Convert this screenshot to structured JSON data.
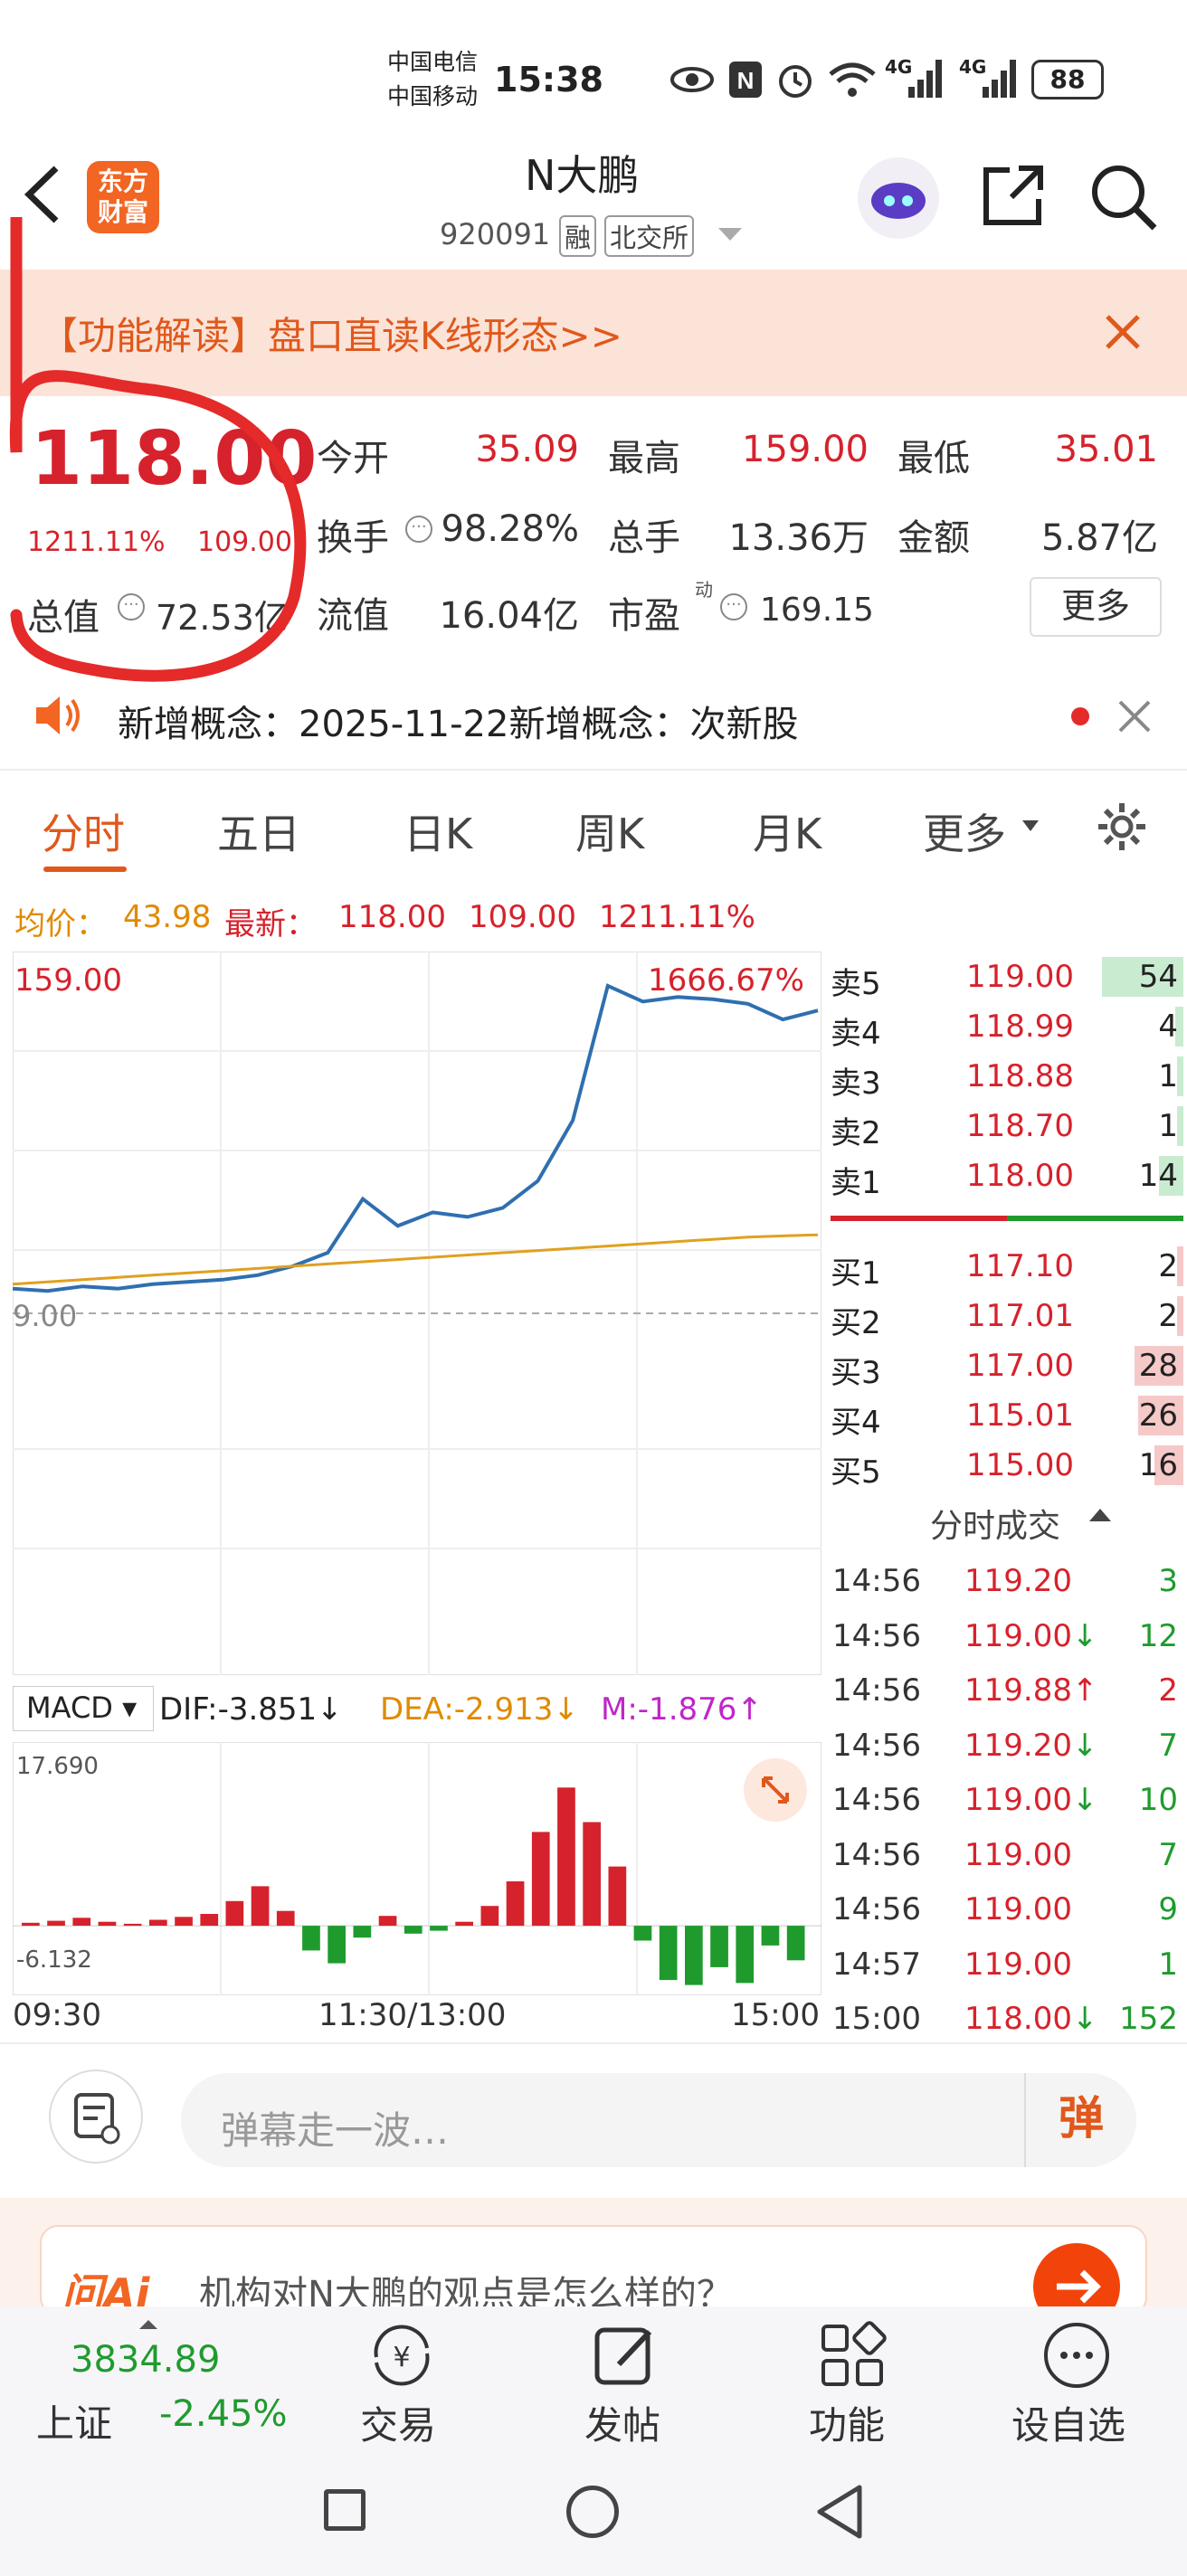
{
  "status": {
    "carrier1": "中国电信",
    "carrier2": "中国移动",
    "time": "15:38",
    "battery": "88",
    "net1": "4G",
    "net2": "4G"
  },
  "header": {
    "title": "N大鹏",
    "code": "920091",
    "tag_margin": "融",
    "tag_exchange": "北交所",
    "logo_line1": "东方",
    "logo_line2": "财富"
  },
  "banner": {
    "text": "【功能解读】盘口直读K线形态>>"
  },
  "quote": {
    "price": "118.00",
    "change_pct": "1211.11%",
    "change_abs": "109.00",
    "open_label": "今开",
    "open": "35.09",
    "high_label": "最高",
    "high": "159.00",
    "low_label": "最低",
    "low": "35.01",
    "turnover_label": "换手",
    "turnover": "98.28%",
    "volume_label": "总手",
    "volume": "13.36万",
    "amount_label": "金额",
    "amount": "5.87亿",
    "mcap_label": "总值",
    "mcap": "72.53亿",
    "float_label": "流值",
    "float_cap": "16.04亿",
    "pe_label": "市盈",
    "pe_sup": "动",
    "pe": "169.15",
    "more": "更多"
  },
  "notice": {
    "text": "新增概念：2025-11-22新增概念：次新股"
  },
  "tabs": [
    "分时",
    "五日",
    "日K",
    "周K",
    "月K",
    "更多"
  ],
  "summary": {
    "avg_label": "均价：",
    "avg": "43.98",
    "latest_label": "最新：",
    "latest": "118.00",
    "chg": "109.00",
    "pct": "1211.11%"
  },
  "chart_data": [
    {
      "type": "line",
      "title": "",
      "ymax_label": "159.00",
      "ymax_pct": "1666.67%",
      "prev_close_label": "9.00",
      "x_labels": [
        "09:30",
        "11:30/13:00",
        "15:00"
      ],
      "series": [
        {
          "values": [
            20,
            19,
            21,
            20,
            22,
            23,
            24,
            26,
            30,
            36,
            60,
            48,
            54,
            52,
            56,
            68,
            95,
            155,
            148,
            150,
            149,
            147,
            140,
            144
          ]
        },
        {
          "values": [
            22,
            23,
            24,
            25,
            26,
            27,
            28,
            29,
            30,
            31,
            32,
            33,
            34,
            35,
            36,
            37,
            38,
            39,
            40,
            41,
            42,
            43,
            43.5,
            43.98
          ]
        }
      ]
    },
    {
      "type": "bar",
      "title": "MACD",
      "indicator": "MACD",
      "dif": "DIF:-3.851↓",
      "dea": "DEA:-2.913↓",
      "m": "M:-1.876↑",
      "ymax": "17.690",
      "ymin": "-6.132",
      "values": [
        0.3,
        0.5,
        0.8,
        0.4,
        0.2,
        0.6,
        0.9,
        1.2,
        2.5,
        4.0,
        1.5,
        -2.5,
        -3.8,
        -1.2,
        1.0,
        -0.8,
        -0.5,
        0.4,
        2.0,
        4.5,
        9.5,
        14.0,
        10.5,
        6.0,
        -1.5,
        -5.5,
        -6.0,
        -4.2,
        -5.8,
        -2.0,
        -3.5
      ]
    }
  ],
  "orderbook": {
    "asks": [
      {
        "label": "卖5",
        "price": "119.00",
        "vol": "54",
        "fill": 0.5
      },
      {
        "label": "卖4",
        "price": "118.99",
        "vol": "4",
        "fill": 0.05
      },
      {
        "label": "卖3",
        "price": "118.88",
        "vol": "1",
        "fill": 0.02
      },
      {
        "label": "卖2",
        "price": "118.70",
        "vol": "1",
        "fill": 0.02
      },
      {
        "label": "卖1",
        "price": "118.00",
        "vol": "14",
        "fill": 0.15
      }
    ],
    "bids": [
      {
        "label": "买1",
        "price": "117.10",
        "vol": "2",
        "fill": 0.02
      },
      {
        "label": "买2",
        "price": "117.01",
        "vol": "2",
        "fill": 0.02
      },
      {
        "label": "买3",
        "price": "117.00",
        "vol": "28",
        "fill": 0.3
      },
      {
        "label": "买4",
        "price": "115.01",
        "vol": "26",
        "fill": 0.28
      },
      {
        "label": "买5",
        "price": "115.00",
        "vol": "16",
        "fill": 0.18
      }
    ]
  },
  "trades": {
    "title": "分时成交",
    "rows": [
      {
        "time": "14:56",
        "price": "119.20",
        "arrow": "",
        "vol": "3",
        "vc": "g",
        "pc": "r"
      },
      {
        "time": "14:56",
        "price": "119.00",
        "arrow": "↓",
        "vol": "12",
        "vc": "g",
        "pc": "r"
      },
      {
        "time": "14:56",
        "price": "119.88",
        "arrow": "↑",
        "vol": "2",
        "vc": "r",
        "pc": "r"
      },
      {
        "time": "14:56",
        "price": "119.20",
        "arrow": "↓",
        "vol": "7",
        "vc": "g",
        "pc": "r"
      },
      {
        "time": "14:56",
        "price": "119.00",
        "arrow": "↓",
        "vol": "10",
        "vc": "g",
        "pc": "r"
      },
      {
        "time": "14:56",
        "price": "119.00",
        "arrow": "",
        "vol": "7",
        "vc": "g",
        "pc": "r"
      },
      {
        "time": "14:56",
        "price": "119.00",
        "arrow": "",
        "vol": "9",
        "vc": "g",
        "pc": "r"
      },
      {
        "time": "14:57",
        "price": "119.00",
        "arrow": "",
        "vol": "1",
        "vc": "g",
        "pc": "r"
      },
      {
        "time": "15:00",
        "price": "118.00",
        "arrow": "↓",
        "vol": "152",
        "vc": "g",
        "pc": "r"
      }
    ]
  },
  "comment": {
    "placeholder": "弹幕走一波…",
    "send": "弹"
  },
  "ai": {
    "logo": "问Ai",
    "text": "机构对N大鹏的观点是怎么样的？"
  },
  "bottom": {
    "index_value": "3834.89",
    "index_name": "上证",
    "index_pct": "-2.45%",
    "trade": "交易",
    "post": "发帖",
    "func": "功能",
    "watch": "设自选"
  },
  "colors": {
    "up": "#d6222c",
    "down": "#1f9b2e",
    "price_line": "#2f6fb0",
    "avg_line": "#e0a020",
    "accent": "#f26522"
  }
}
